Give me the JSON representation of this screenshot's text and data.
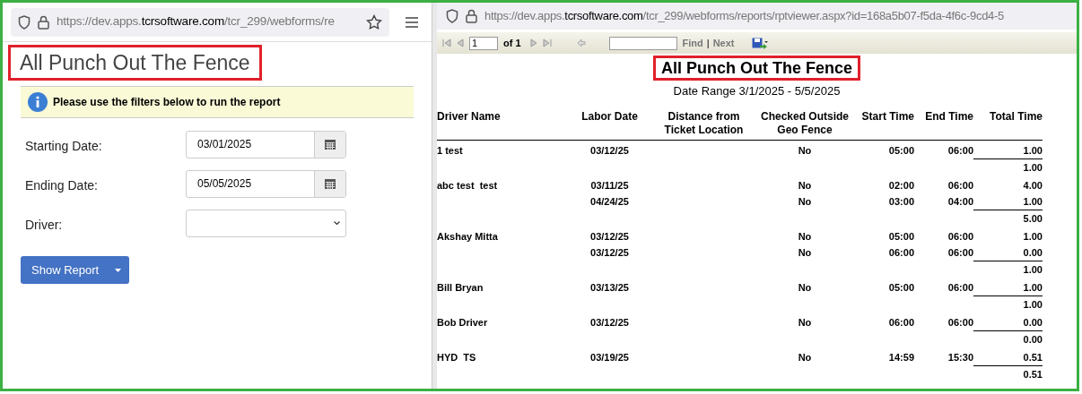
{
  "left_browser": {
    "url_prefix": "https://dev.apps.",
    "url_domain": "tcrsoftware.com",
    "url_path": "/tcr_299/webforms/re"
  },
  "form": {
    "title": "All Punch Out The Fence",
    "info": "Please use the filters below to run the report",
    "fields": [
      {
        "kind": "date",
        "label": "Starting Date:",
        "value": "03/01/2025"
      },
      {
        "kind": "date",
        "label": "Ending Date:",
        "value": "05/05/2025"
      },
      {
        "kind": "select",
        "label": "Driver:"
      }
    ],
    "button": "Show Report"
  },
  "right_browser": {
    "url_prefix": "https://dev.apps.",
    "url_domain": "tcrsoftware.com",
    "url_path": "/tcr_299/webforms/reports/rptviewer.aspx?id=168a5b07-f5da-4f6c-9cd4-5"
  },
  "toolbar": {
    "page": "1",
    "page_count": "of 1",
    "find": "Find",
    "separator": "|",
    "next": "Next"
  },
  "report": {
    "title": "All Punch Out The Fence",
    "subtitle": "Date Range 3/1/2025 - 5/5/2025",
    "columns": [
      "Driver Name",
      "Labor Date",
      "Distance from Ticket Location",
      "Checked Outside Geo Fence",
      "Start Time",
      "End Time",
      "Total Time"
    ],
    "drivers": [
      {
        "name": "1 test",
        "entries": [
          {
            "labor_date": "03/12/25",
            "outside": "No",
            "start": "05:00",
            "end": "06:00",
            "total": "1.00"
          }
        ],
        "subtotal": "1.00"
      },
      {
        "name": "abc test  test",
        "entries": [
          {
            "labor_date": "03/11/25",
            "outside": "No",
            "start": "02:00",
            "end": "06:00",
            "total": "4.00"
          },
          {
            "labor_date": "04/24/25",
            "outside": "No",
            "start": "03:00",
            "end": "04:00",
            "total": "1.00"
          }
        ],
        "subtotal": "5.00"
      },
      {
        "name": "Akshay Mitta",
        "entries": [
          {
            "labor_date": "03/12/25",
            "outside": "No",
            "start": "05:00",
            "end": "06:00",
            "total": "1.00"
          },
          {
            "labor_date": "03/12/25",
            "outside": "No",
            "start": "06:00",
            "end": "06:00",
            "total": "0.00"
          }
        ],
        "subtotal": "1.00"
      },
      {
        "name": "Bill Bryan",
        "entries": [
          {
            "labor_date": "03/13/25",
            "outside": "No",
            "start": "05:00",
            "end": "06:00",
            "total": "1.00"
          }
        ],
        "subtotal": "1.00"
      },
      {
        "name": "Bob Driver",
        "entries": [
          {
            "labor_date": "03/12/25",
            "outside": "No",
            "start": "06:00",
            "end": "06:00",
            "total": "0.00"
          }
        ],
        "subtotal": "0.00"
      },
      {
        "name": "HYD  TS",
        "entries": [
          {
            "labor_date": "03/19/25",
            "outside": "No",
            "start": "14:59",
            "end": "15:30",
            "total": "0.51"
          }
        ],
        "subtotal": "0.51"
      }
    ]
  }
}
